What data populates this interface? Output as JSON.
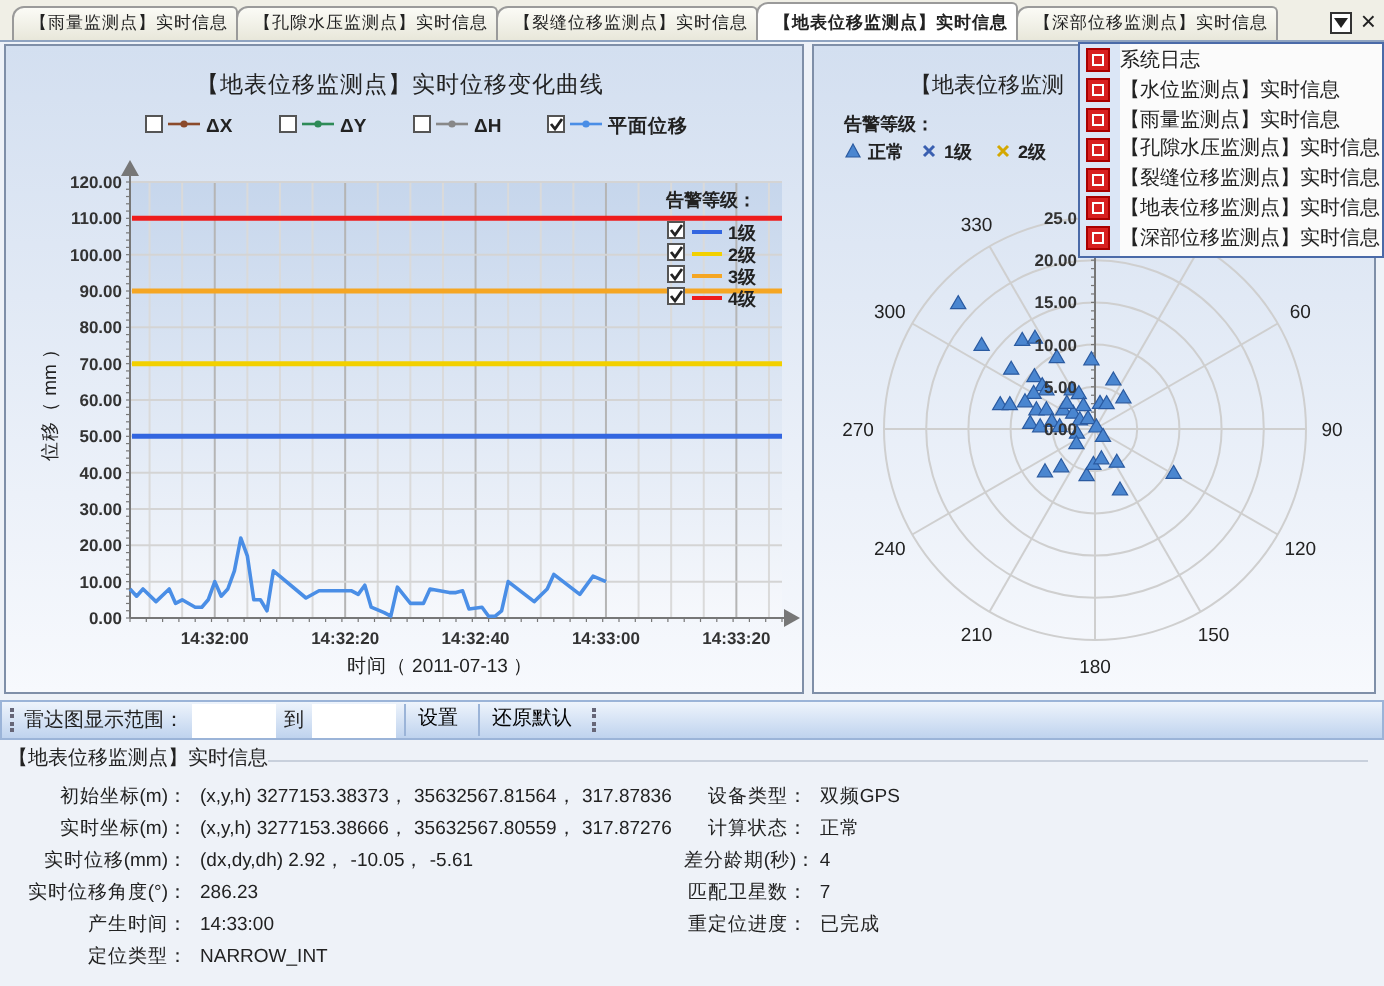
{
  "tabs": [
    {
      "label": "【雨量监测点】实时信息",
      "selected": false
    },
    {
      "label": "【孔隙水压监测点】实时信息",
      "selected": false
    },
    {
      "label": "【裂缝位移监测点】实时信息",
      "selected": false
    },
    {
      "label": "【地表位移监测点】实时信息",
      "selected": true
    },
    {
      "label": "【深部位移监测点】实时信息",
      "selected": false
    }
  ],
  "tab_close": "×",
  "line_chart": {
    "legend_checked": [
      false,
      false,
      false,
      true
    ],
    "alarm_title": "告警等级：",
    "alarm_checked": [
      true,
      true,
      true,
      true
    ],
    "chart_data": {
      "type": "line",
      "title": "【地表位移监测点】实时位移变化曲线",
      "xlabel": "时间（ 2011-07-13 ）",
      "ylabel": "位移（ mm ）",
      "xlim": [
        52307,
        52407
      ],
      "ylim": [
        0,
        120
      ],
      "xticks": [
        {
          "value": 52320,
          "label": "14:32:00"
        },
        {
          "value": 52340,
          "label": "14:32:20"
        },
        {
          "value": 52360,
          "label": "14:32:40"
        },
        {
          "value": 52380,
          "label": "14:33:00"
        },
        {
          "value": 52400,
          "label": "14:33:20"
        }
      ],
      "yticks": [
        {
          "value": 0,
          "label": "0.00"
        },
        {
          "value": 10,
          "label": "10.00"
        },
        {
          "value": 20,
          "label": "20.00"
        },
        {
          "value": 30,
          "label": "30.00"
        },
        {
          "value": 40,
          "label": "40.00"
        },
        {
          "value": 50,
          "label": "50.00"
        },
        {
          "value": 60,
          "label": "60.00"
        },
        {
          "value": 70,
          "label": "70.00"
        },
        {
          "value": 80,
          "label": "80.00"
        },
        {
          "value": 90,
          "label": "90.00"
        },
        {
          "value": 100,
          "label": "100.00"
        },
        {
          "value": 110,
          "label": "110.00"
        },
        {
          "value": 120,
          "label": "120.00"
        }
      ],
      "x": [
        52307,
        52308,
        52309,
        52311,
        52313,
        52314,
        52315,
        52317,
        52318,
        52319,
        52320,
        52321,
        52322,
        52323,
        52324,
        52325,
        52326,
        52327,
        52328,
        52329,
        52334,
        52336,
        52341,
        52342,
        52343,
        52344,
        52346,
        52347,
        52348,
        52350,
        52352,
        52353,
        52356,
        52357,
        52358,
        52359,
        52361,
        52362,
        52363,
        52364,
        52365,
        52369,
        52371,
        52372,
        52376,
        52378,
        52380
      ],
      "series": [
        {
          "name": "ΔX",
          "color": "#8b4a2b",
          "values": [
            null,
            null,
            null,
            null,
            null,
            null,
            null,
            null,
            null,
            null,
            null,
            null,
            null,
            null,
            null,
            null,
            null,
            null,
            null,
            null,
            null,
            null,
            null,
            null,
            null,
            null,
            null,
            null,
            null,
            null,
            null,
            null,
            null,
            null,
            null,
            null,
            null,
            null,
            null,
            null,
            null,
            null,
            null,
            null,
            null,
            null,
            null
          ]
        },
        {
          "name": "ΔY",
          "color": "#2e8b57",
          "values": [
            null,
            null,
            null,
            null,
            null,
            null,
            null,
            null,
            null,
            null,
            null,
            null,
            null,
            null,
            null,
            null,
            null,
            null,
            null,
            null,
            null,
            null,
            null,
            null,
            null,
            null,
            null,
            null,
            null,
            null,
            null,
            null,
            null,
            null,
            null,
            null,
            null,
            null,
            null,
            null,
            null,
            null,
            null,
            null,
            null,
            null,
            null
          ]
        },
        {
          "name": "ΔH",
          "color": "#888888",
          "values": [
            null,
            null,
            null,
            null,
            null,
            null,
            null,
            null,
            null,
            null,
            null,
            null,
            null,
            null,
            null,
            null,
            null,
            null,
            null,
            null,
            null,
            null,
            null,
            null,
            null,
            null,
            null,
            null,
            null,
            null,
            null,
            null,
            null,
            null,
            null,
            null,
            null,
            null,
            null,
            null,
            null,
            null,
            null,
            null,
            null,
            null,
            null
          ]
        },
        {
          "name": "平面位移",
          "color": "#4a8ee6",
          "values": [
            8,
            6,
            8,
            4.5,
            8,
            4,
            5,
            3,
            3,
            5,
            10,
            6,
            8,
            13,
            22,
            17,
            5,
            5,
            2,
            13,
            5.5,
            7.5,
            7.5,
            6.5,
            9,
            3,
            1.5,
            0.5,
            8.5,
            4,
            4,
            8,
            7,
            7,
            7.5,
            2.5,
            3,
            0.5,
            0.5,
            2,
            10,
            4.5,
            8,
            12,
            6.5,
            11.5,
            10
          ]
        }
      ],
      "grid": true,
      "legend": "top",
      "ref_lines": [
        {
          "axis": "y",
          "value": 50,
          "label": "1级",
          "color": "#3366e0"
        },
        {
          "axis": "y",
          "value": 70,
          "label": "2级",
          "color": "#f2d000"
        },
        {
          "axis": "y",
          "value": 90,
          "label": "3级",
          "color": "#f5a623"
        },
        {
          "axis": "y",
          "value": 110,
          "label": "4级",
          "color": "#ee1c1c"
        }
      ]
    }
  },
  "radar_chart": {
    "title": "【地表位移监测",
    "legend_title": "告警等级：",
    "legend": [
      {
        "label": "正常",
        "kind": "triangle",
        "color": "#4a86d0"
      },
      {
        "label": "1级",
        "kind": "cross",
        "color": "#3a5fb0"
      },
      {
        "label": "2级",
        "kind": "cross",
        "color": "#d4a800"
      }
    ],
    "radial_labels": [
      "25.0",
      "20.00",
      "15.00",
      "10.00",
      "5.00",
      "0.00"
    ],
    "angle_labels": [
      "60",
      "90",
      "120",
      "150",
      "180",
      "210",
      "240",
      "270",
      "300",
      "330"
    ]
  },
  "toolbar": {
    "range_label": "雷达图显示范围：",
    "to_label": "到",
    "buttons": [
      "设置",
      "还原默认"
    ]
  },
  "info": {
    "title": "【地表位移监测点】实时信息",
    "left": [
      {
        "label": "初始坐标(m)：",
        "value": "(x,y,h) 3277153.38373， 35632567.81564， 317.87836"
      },
      {
        "label": "实时坐标(m)：",
        "value": "(x,y,h) 3277153.38666， 35632567.80559， 317.87276"
      },
      {
        "label": "实时位移(mm)：",
        "value": "(dx,dy,dh) 2.92， -10.05， -5.61"
      },
      {
        "label": "实时位移角度(°)：",
        "value": "286.23"
      },
      {
        "label": "产生时间：",
        "value": "14:33:00"
      },
      {
        "label": "定位类型：",
        "value": "NARROW_INT"
      }
    ],
    "right": [
      {
        "label": "设备类型：",
        "value": "双频GPS"
      },
      {
        "label": "计算状态：",
        "value": "正常"
      },
      {
        "label": "差分龄期(秒)：",
        "value": "4"
      },
      {
        "label": "匹配卫星数：",
        "value": "7"
      },
      {
        "label": "重定位进度：",
        "value": "已完成"
      }
    ]
  },
  "menu": {
    "items": [
      "系统日志",
      "【水位监测点】实时信息",
      "【雨量监测点】实时信息",
      "【孔隙水压监测点】实时信息",
      "【裂缝位移监测点】实时信息",
      "【地表位移监测点】实时信息",
      "【深部位移监测点】实时信息"
    ]
  }
}
